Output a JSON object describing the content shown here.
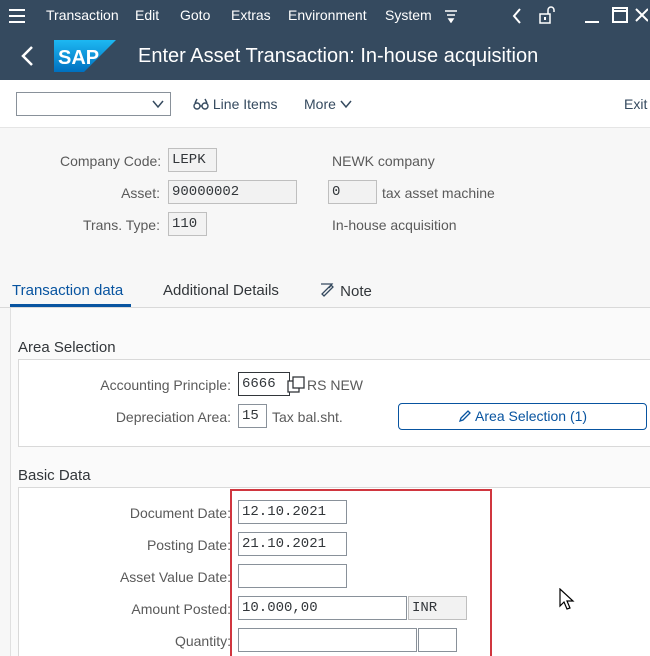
{
  "menubar": {
    "items": [
      {
        "label": "Transaction"
      },
      {
        "label": "Edit"
      },
      {
        "label": "Goto"
      },
      {
        "label": "Extras"
      },
      {
        "label": "Environment"
      },
      {
        "label": "System"
      }
    ]
  },
  "titlebar": {
    "logo_text": "SAP",
    "title": "Enter Asset Transaction: In-house acquisition"
  },
  "toolbar": {
    "select_value": "",
    "line_items_label": "Line Items",
    "more_label": "More",
    "exit_label": "Exit"
  },
  "header": {
    "company_code_label": "Company Code:",
    "company_code_value": "LEPK",
    "company_name": "NEWK company",
    "asset_label": "Asset:",
    "asset_value": "90000002",
    "asset_sub_value": "0",
    "asset_desc": "tax asset machine",
    "trans_type_label": "Trans. Type:",
    "trans_type_value": "110",
    "trans_type_desc": "In-house acquisition"
  },
  "tabs": [
    {
      "label": "Transaction data",
      "active": true
    },
    {
      "label": "Additional Details",
      "active": false
    },
    {
      "label": "Note",
      "active": false
    }
  ],
  "area_selection": {
    "title": "Area Selection",
    "acc_principle_label": "Accounting Principle:",
    "acc_principle_value": "6666",
    "acc_principle_desc": "RS NEW",
    "dep_area_label": "Depreciation Area:",
    "dep_area_value": "15",
    "dep_area_desc": "Tax bal.sht.",
    "button_label": "Area Selection (1)"
  },
  "basic_data": {
    "title": "Basic Data",
    "doc_date_label": "Document Date:",
    "doc_date_value": "12.10.2021",
    "posting_date_label": "Posting Date:",
    "posting_date_value": "21.10.2021",
    "asset_value_date_label": "Asset Value Date:",
    "asset_value_date_value": "",
    "amount_label": "Amount Posted:",
    "amount_value": "10.000,00",
    "currency": "INR",
    "quantity_label": "Quantity:",
    "quantity_value": "",
    "quantity_unit": ""
  },
  "colors": {
    "shell": "#354a5f",
    "accent": "#0854a0",
    "highlight": "#d0363f"
  }
}
